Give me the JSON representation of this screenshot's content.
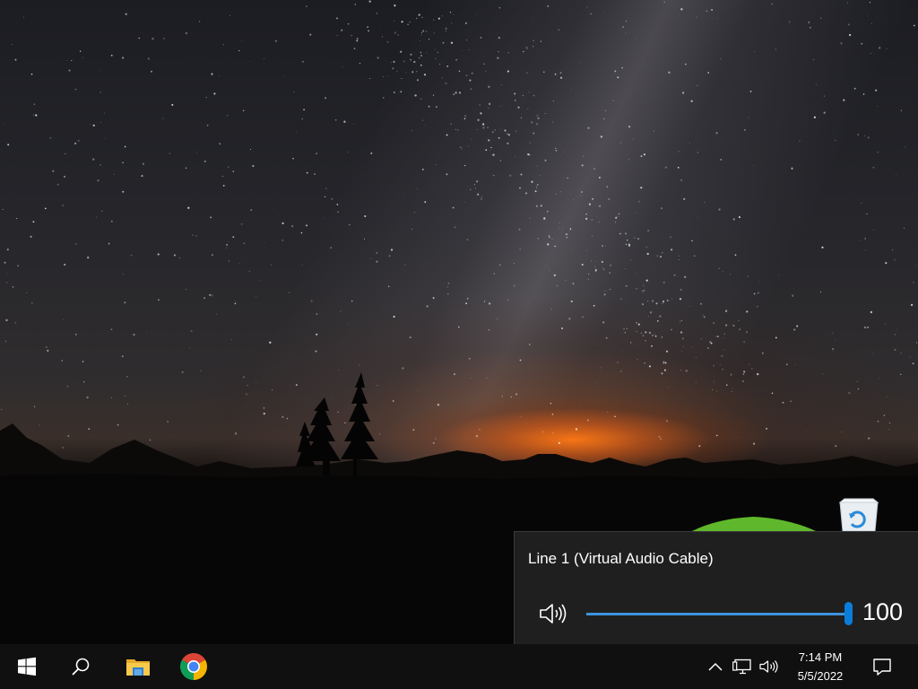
{
  "desktop": {
    "wallpaper": "night-sky-milky-way-mountains",
    "icons": [
      {
        "name": "recycle-bin",
        "icon": "recycle-bin-icon",
        "label": ""
      }
    ]
  },
  "volume_flyout": {
    "device_name": "Line 1 (Virtual Audio Cable)",
    "volume_value": "100",
    "volume_level": 1.0,
    "speaker_icon": "speaker-volume-icon",
    "accent_color": "#0a7ddb"
  },
  "taskbar": {
    "background": "#101010",
    "start_icon": "windows-start-icon",
    "pinned": [
      {
        "name": "search",
        "icon": "search-icon"
      },
      {
        "name": "file-explorer",
        "icon": "file-explorer-icon"
      },
      {
        "name": "chrome",
        "icon": "chrome-icon"
      }
    ],
    "tray": {
      "icons": [
        "chevron-up-icon",
        "network-icon",
        "volume-icon"
      ],
      "time": "7:14 PM",
      "date": "5/5/2022"
    },
    "notification_icon": "action-center-icon"
  }
}
